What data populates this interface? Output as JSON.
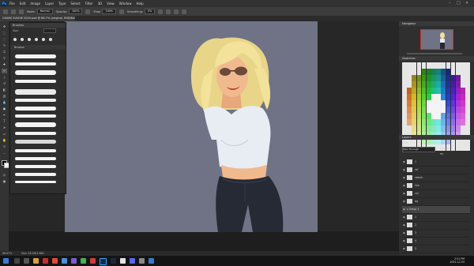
{
  "menubar": {
    "logo": "Ps",
    "items": [
      "File",
      "Edit",
      "Image",
      "Layer",
      "Type",
      "Select",
      "Filter",
      "3D",
      "View",
      "Window",
      "Help"
    ]
  },
  "options": {
    "mode_label": "Mode:",
    "mode_value": "Normal",
    "opacity_label": "Opacity:",
    "opacity_value": "100%",
    "flow_label": "Flow:",
    "flow_value": "100%",
    "smoothing_label": "Smoothing:",
    "smoothing_value": "0%"
  },
  "document": {
    "tab_title": "CHARS SUVIVE 2020.psd @ 66.7% (original, RGB/8#)"
  },
  "brushes": {
    "title": "Brushes",
    "size_label": "Size:",
    "size_value": "25 px",
    "group_label": "Brushes"
  },
  "status": {
    "zoom": "66.67%",
    "doc_info": "Doc: 28.1M/1.98G"
  },
  "panels": {
    "navigator": "Navigator",
    "swatches": "Swatches",
    "layers": "Layers",
    "kind": "Kind",
    "blend": "Pass Through",
    "opacity_label": "Opacity:",
    "fill_label": "Fill:",
    "layer_names": [
      "1",
      "ref",
      "sketch",
      "line",
      "col",
      "bg",
      "Group 1",
      "1",
      "2",
      "3",
      "4",
      "5"
    ]
  },
  "clock": {
    "time": "2:51 PM",
    "date": "2021-12-03"
  },
  "colors": {
    "canvas": "#6f7385",
    "hair": "#f2e29a",
    "shirt": "#e8ecf3",
    "jeans": "#262a35",
    "skin": "#f1b98e",
    "ps_blue": "#31a8ff"
  }
}
